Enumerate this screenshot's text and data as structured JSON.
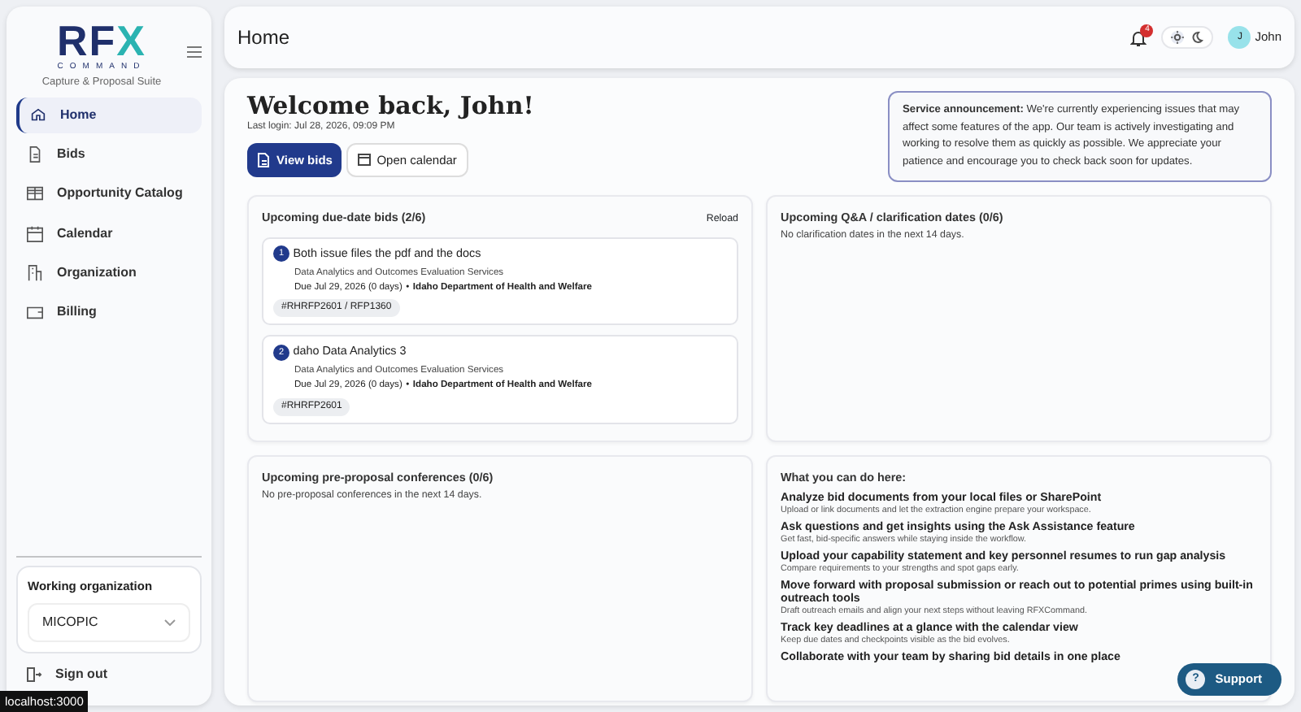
{
  "sidebar": {
    "logo": {
      "title": "RFX",
      "subtitle": "COMMAND",
      "tagline": "Capture & Proposal Suite"
    },
    "items": [
      {
        "label": "Home",
        "selected": true
      },
      {
        "label": "Bids",
        "selected": false
      },
      {
        "label": "Opportunity Catalog",
        "selected": false
      },
      {
        "label": "Calendar",
        "selected": false
      },
      {
        "label": "Organization",
        "selected": false
      },
      {
        "label": "Billing",
        "selected": false
      }
    ],
    "working_organization": {
      "label": "Working organization",
      "value": "MICOPIC"
    },
    "sign_out": "Sign out"
  },
  "topbar": {
    "title": "Home",
    "notifications": "4",
    "light_theme": true,
    "user": {
      "initial": "J",
      "name": "John"
    }
  },
  "welcome": {
    "heading": "Welcome back, John!",
    "last_login": "Last login: Jul 28, 2026, 09:09 PM",
    "buttons": [
      {
        "label": "View bids",
        "kind": "primary"
      },
      {
        "label": "Open calendar",
        "kind": "secondary"
      }
    ],
    "announcement": "**Service announcement:** We're currently experiencing issues that may affect some features of the app. Our team is actively investigating and working to resolve them as quickly as possible. We appreciate your patience and encourage you to check back soon for updates."
  },
  "panels": [
    {
      "title": "Upcoming due-date bids (2/6)",
      "action": "Reload",
      "bids": [
        {
          "number": "1",
          "title": "Both issue files the pdf and the docs",
          "subtitle": "Data Analytics and Outcomes Evaluation Services",
          "due": "Due Jul 29, 2026 (0 days)",
          "separator": "•",
          "agency": "Idaho Department of Health and Welfare",
          "tag": "#RHRFP2601 / RFP1360"
        },
        {
          "number": "2",
          "title": "daho Data Analytics 3",
          "subtitle": "Data Analytics and Outcomes Evaluation Services",
          "due": "Due Jul 29, 2026 (0 days)",
          "separator": "•",
          "agency": "Idaho Department of Health and Welfare",
          "tag": "#RHRFP2601"
        }
      ]
    },
    {
      "title": "Upcoming Q&A / clarification dates (0/6)",
      "empty": "No clarification dates in the next 14 days."
    },
    {
      "title": "Upcoming pre-proposal conferences (0/6)",
      "empty": "No pre-proposal conferences in the next 14 days."
    },
    {
      "title": "What you can do here:",
      "tips": [
        {
          "heading": "Analyze bid documents from your local files or SharePoint",
          "text": "Upload or link documents and let the extraction engine prepare your workspace."
        },
        {
          "heading": "Ask questions and get insights using the Ask Assistance feature",
          "text": "Get fast, bid-specific answers while staying inside the workflow."
        },
        {
          "heading": "Upload your capability statement and key personnel resumes to run gap analysis",
          "text": "Compare requirements to your strengths and spot gaps early."
        },
        {
          "heading": "Move forward with proposal submission or reach out to potential primes using built-in outreach tools",
          "text": "Draft outreach emails and align your next steps without leaving RFXCommand."
        },
        {
          "heading": "Track key deadlines at a glance with the calendar view",
          "text": "Keep due dates and checkpoints visible as the bid evolves."
        },
        {
          "heading": "Collaborate with your team by sharing bid details in one place"
        }
      ]
    }
  ],
  "support": {
    "icon_text": "?",
    "label": "Support"
  },
  "status_bar": "localhost:3000"
}
